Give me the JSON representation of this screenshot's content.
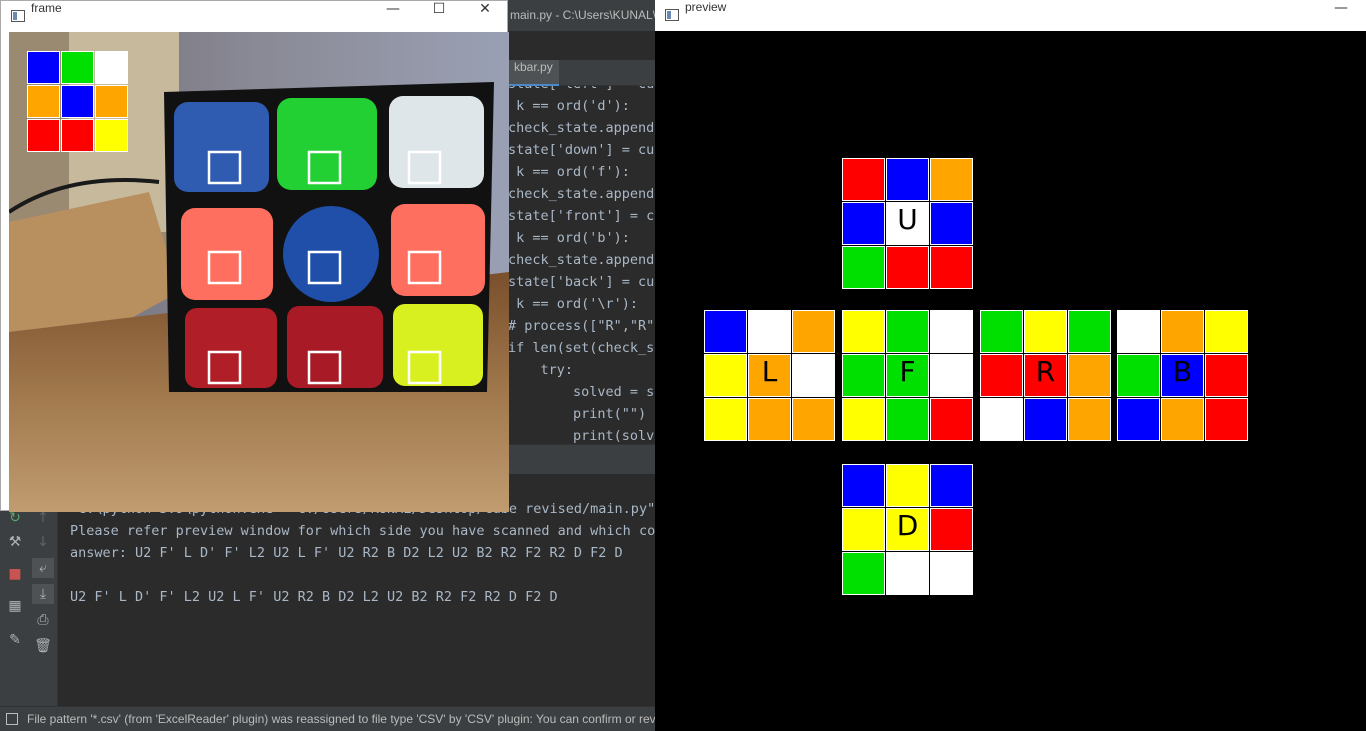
{
  "colors": {
    "blue": "#0000ff",
    "green": "#00e000",
    "white": "#ffffff",
    "orange": "#ffa500",
    "red": "#ff0000",
    "yellow": "#ffff00"
  },
  "ide": {
    "title_fragment": "main.py - C:\\Users\\KUNAL\\",
    "tab_label": "kbar.py",
    "code_lines": [
      "state['left'] = cur",
      " k == ord('d'):",
      "check_state.append(",
      "state['down'] = cur",
      " k == ord('f'):",
      "check_state.append(",
      "state['front'] = cu",
      " k == ord('b'):",
      "check_state.append(",
      "state['back'] = cur",
      " k == ord('\\r'):",
      "# process([\"R\",\"R\"",
      "if len(set(check_st",
      "    try:",
      "        solved = so",
      "        print(\"\")",
      "        print(solve"
    ],
    "console_lines": [
      "\"C:\\python 3.9\\python.exe\" \"C:/Users/KUNAL/Desktop/cube revised/main.py\"",
      "Please refer preview window for which side you have scanned and which col",
      "answer: U2 F' L D' F' L2 U2 L F' U2 R2 B D2 L2 U2 B2 R2 F2 R2 D F2 D",
      "",
      "U2 F' L D' F' L2 U2 L F' U2 R2 B D2 L2 U2 B2 R2 F2 R2 D F2 D"
    ],
    "status_text": "File pattern '*.csv' (from 'ExcelReader' plugin) was reassigned to file type 'CSV' by 'CSV' plugin: You can confirm or reve"
  },
  "frame_window": {
    "title": "frame",
    "minimize_label": "—",
    "maximize_label": "☐",
    "close_label": "✕",
    "detected_grid": [
      "blue",
      "green",
      "white",
      "orange",
      "blue",
      "orange",
      "red",
      "red",
      "yellow"
    ]
  },
  "preview_window": {
    "title": "preview",
    "minimize_label": "—",
    "faces": [
      {
        "id": "up",
        "label": "U",
        "stickers": [
          "red",
          "blue",
          "orange",
          "blue",
          "white",
          "blue",
          "green",
          "red",
          "red"
        ]
      },
      {
        "id": "left",
        "label": "L",
        "stickers": [
          "blue",
          "white",
          "orange",
          "yellow",
          "orange",
          "white",
          "yellow",
          "orange",
          "orange"
        ]
      },
      {
        "id": "front",
        "label": "F",
        "stickers": [
          "yellow",
          "green",
          "white",
          "green",
          "green",
          "white",
          "yellow",
          "green",
          "red"
        ]
      },
      {
        "id": "right",
        "label": "R",
        "stickers": [
          "green",
          "yellow",
          "green",
          "red",
          "red",
          "orange",
          "white",
          "blue",
          "orange"
        ]
      },
      {
        "id": "back",
        "label": "B",
        "stickers": [
          "white",
          "orange",
          "yellow",
          "green",
          "blue",
          "red",
          "blue",
          "orange",
          "red"
        ]
      },
      {
        "id": "down",
        "label": "D",
        "stickers": [
          "blue",
          "yellow",
          "blue",
          "yellow",
          "yellow",
          "red",
          "green",
          "white",
          "white"
        ]
      }
    ]
  }
}
